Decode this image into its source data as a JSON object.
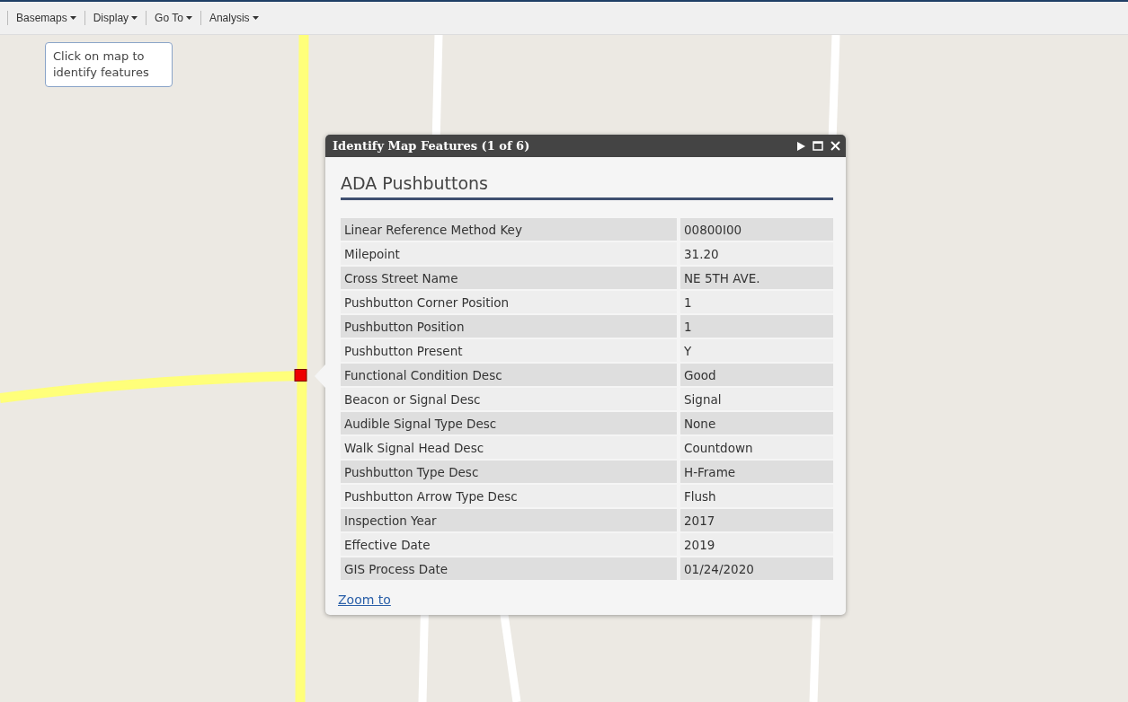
{
  "toolbar": {
    "menus": [
      {
        "label": "Basemaps"
      },
      {
        "label": "Display"
      },
      {
        "label": "Go To"
      },
      {
        "label": "Analysis"
      }
    ]
  },
  "map": {
    "kind": "picture",
    "hint": "Click on map to identify features"
  },
  "popup": {
    "title": "Identify Map Features (1 of 6)",
    "layer": "ADA Pushbuttons",
    "rows": [
      {
        "label": "Linear Reference Method Key",
        "value": "00800I00"
      },
      {
        "label": "Milepoint",
        "value": "31.20"
      },
      {
        "label": "Cross Street Name",
        "value": "NE 5TH AVE."
      },
      {
        "label": "Pushbutton Corner Position",
        "value": "1"
      },
      {
        "label": "Pushbutton Position",
        "value": "1"
      },
      {
        "label": "Pushbutton Present",
        "value": "Y"
      },
      {
        "label": "Functional Condition Desc",
        "value": "Good"
      },
      {
        "label": "Beacon or Signal Desc",
        "value": "Signal"
      },
      {
        "label": "Audible Signal Type Desc",
        "value": "None"
      },
      {
        "label": "Walk Signal Head Desc",
        "value": "Countdown"
      },
      {
        "label": "Pushbutton Type Desc",
        "value": "H-Frame"
      },
      {
        "label": "Pushbutton Arrow Type Desc",
        "value": "Flush"
      },
      {
        "label": "Inspection Year",
        "value": "2017"
      },
      {
        "label": "Effective Date",
        "value": "2019"
      },
      {
        "label": "GIS Process Date",
        "value": "01/24/2020"
      }
    ],
    "link": "Zoom to"
  }
}
